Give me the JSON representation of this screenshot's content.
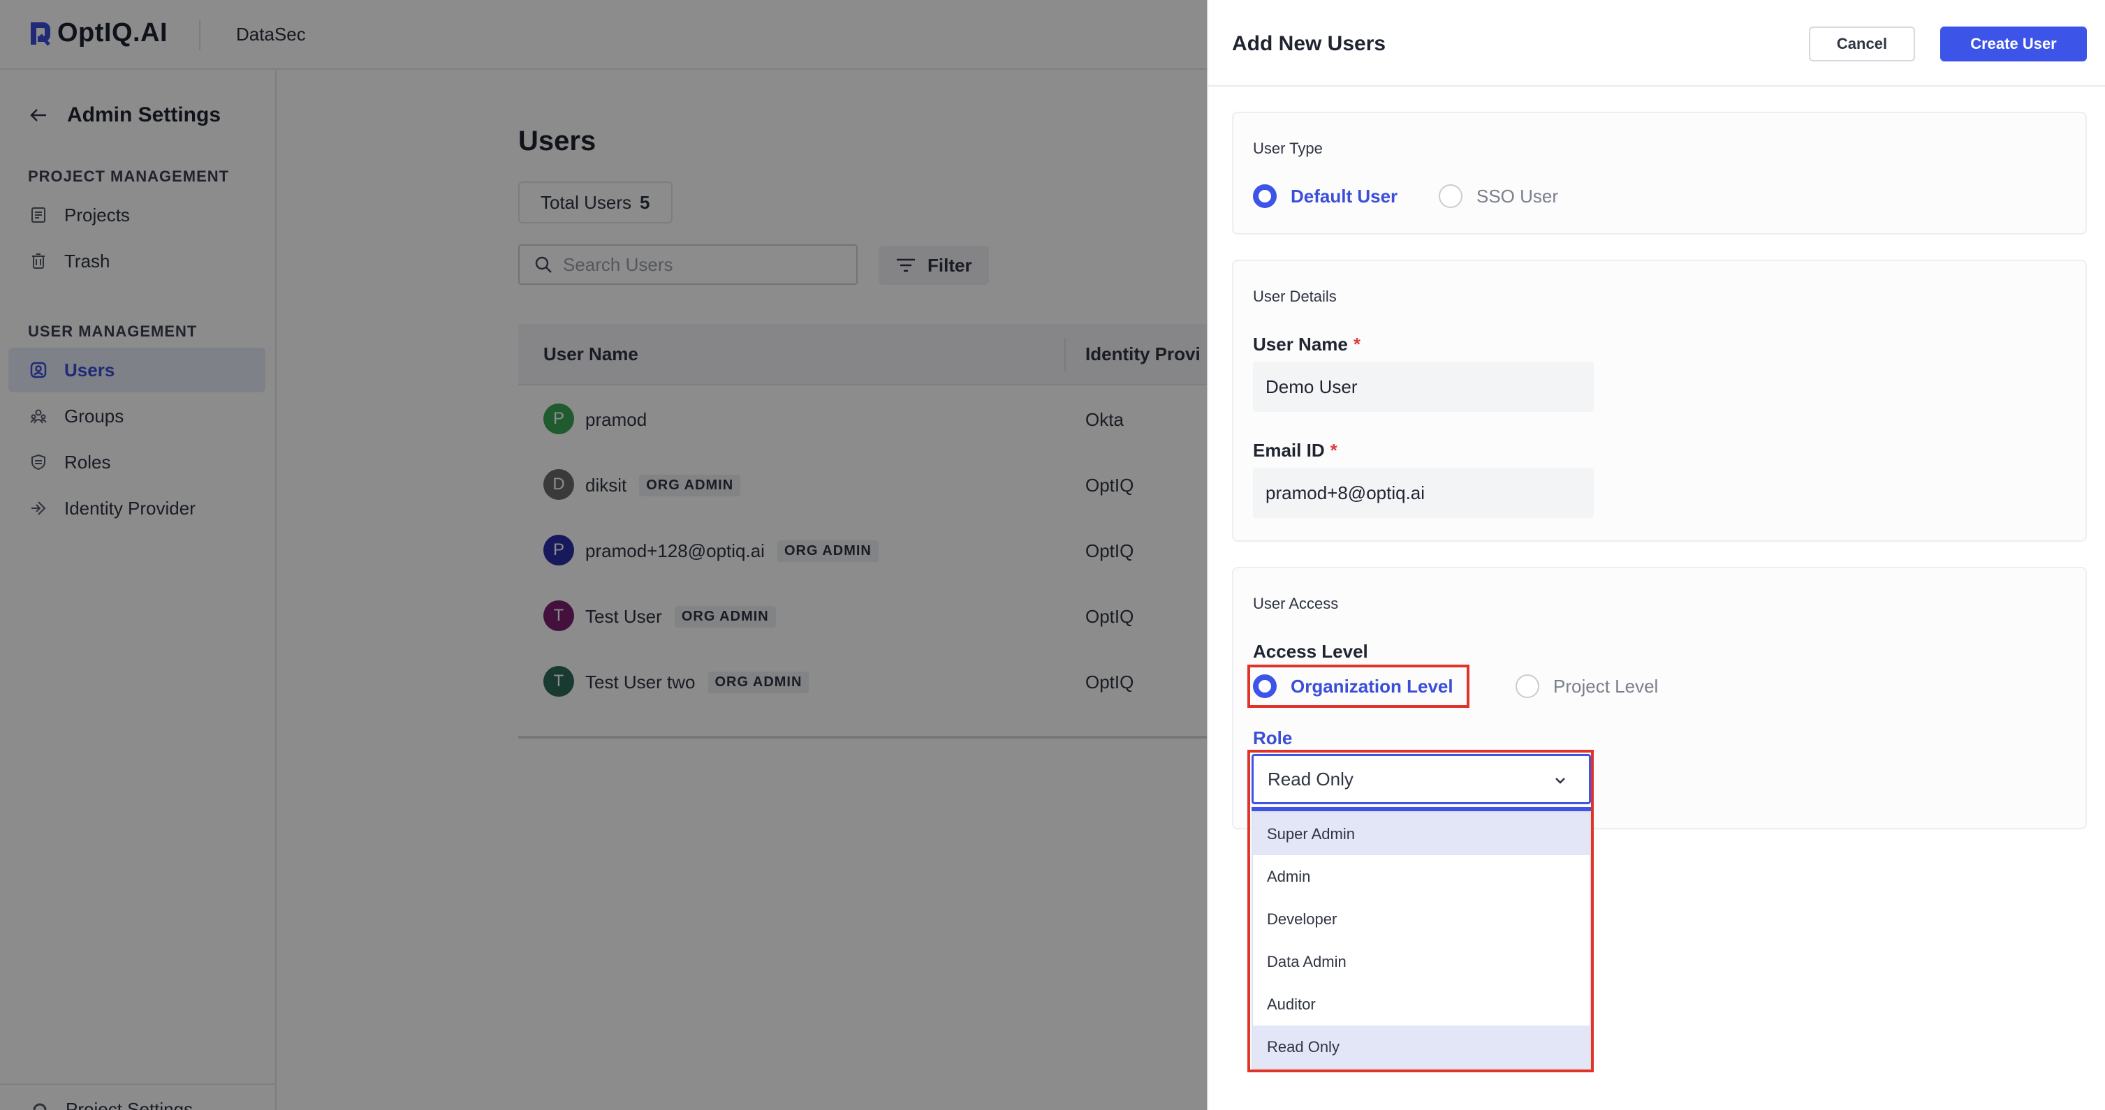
{
  "app": {
    "logo_text": "OptIQ.AI",
    "product": "DataSec"
  },
  "sidebar": {
    "title": "Admin Settings",
    "sections": [
      {
        "label": "PROJECT MANAGEMENT"
      },
      {
        "label": "USER MANAGEMENT"
      }
    ],
    "items": [
      {
        "label": "Projects",
        "icon": "projects-icon"
      },
      {
        "label": "Trash",
        "icon": "trash-icon"
      },
      {
        "label": "Users",
        "icon": "users-icon",
        "active": true
      },
      {
        "label": "Groups",
        "icon": "groups-icon"
      },
      {
        "label": "Roles",
        "icon": "roles-icon"
      },
      {
        "label": "Identity Provider",
        "icon": "identity-provider-icon"
      }
    ],
    "bottom_item": "Project Settings"
  },
  "main": {
    "title": "Users",
    "total_label": "Total Users",
    "total_count": "5",
    "search_placeholder": "Search Users",
    "filter_label": "Filter",
    "columns": [
      "User Name",
      "Identity Provi"
    ],
    "rows": [
      {
        "initial": "P",
        "name": "pramod",
        "badge": "",
        "idp": "Okta",
        "color": "#3aa757"
      },
      {
        "initial": "D",
        "name": "diksit",
        "badge": "ORG ADMIN",
        "idp": "OptIQ",
        "color": "#6b6b6b"
      },
      {
        "initial": "P",
        "name": "pramod+128@optiq.ai",
        "badge": "ORG ADMIN",
        "idp": "OptIQ",
        "color": "#2c2ca8"
      },
      {
        "initial": "T",
        "name": "Test User",
        "badge": "ORG ADMIN",
        "idp": "OptIQ",
        "color": "#7a1f6e"
      },
      {
        "initial": "T",
        "name": "Test User two",
        "badge": "ORG ADMIN",
        "idp": "OptIQ",
        "color": "#2d6b58"
      }
    ]
  },
  "drawer": {
    "title": "Add New Users",
    "cancel_label": "Cancel",
    "create_label": "Create User",
    "user_type": {
      "label": "User Type",
      "options": [
        "Default User",
        "SSO User"
      ],
      "selected": "Default User"
    },
    "user_details": {
      "label": "User Details",
      "username_label": "User Name",
      "username_value": "Demo User",
      "email_label": "Email ID",
      "email_value": "pramod+8@optiq.ai",
      "required_mark": "*"
    },
    "user_access": {
      "label": "User Access",
      "access_level_label": "Access Level",
      "options": [
        "Organization Level",
        "Project Level"
      ],
      "selected": "Organization Level",
      "role_label": "Role",
      "role_value": "Read Only",
      "role_options": [
        "Super Admin",
        "Admin",
        "Developer",
        "Data Admin",
        "Auditor",
        "Read Only"
      ]
    }
  },
  "colors": {
    "accent": "#3d54e8",
    "highlight_outline": "#e0342a",
    "overlay": "rgba(0,0,0,0.45)"
  }
}
